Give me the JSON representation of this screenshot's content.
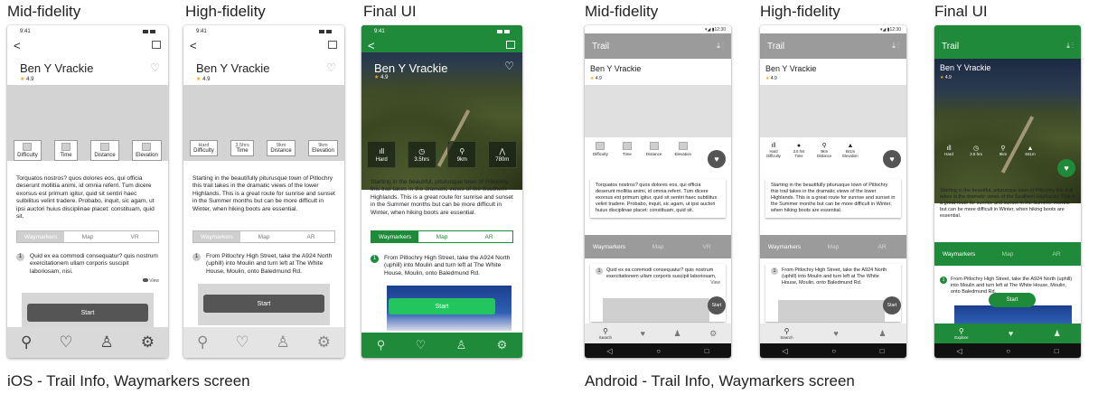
{
  "headings": {
    "ios_mid": "Mid-fidelity",
    "ios_high": "High-fidelity",
    "ios_final": "Final UI",
    "and_mid": "Mid-fidelity",
    "and_high": "High-fidelity",
    "and_final": "Final UI"
  },
  "captions": {
    "ios": "iOS - Trail Info, Waymarkers screen",
    "android": "Android - Trail Info, Waymarkers screen"
  },
  "trail": {
    "name": "Ben Y Vrackie",
    "rating": "4.9",
    "star": "★"
  },
  "status": {
    "ios_time": "9:41",
    "android_time": "12:30"
  },
  "ios_mid": {
    "stats": [
      "Difficulty",
      "Time",
      "Distance",
      "Elevation"
    ],
    "description": "Torquatos nostros? quos dolores eos, qui officia deserunt mollitia animi, id omnia referri. Tum dicere exorsus est primum igitur, quid sit sentiri haec sulbilitus velint tradere. Probabo, inquit, sic agam, ut ipsi auctori huius disciplinae placet: constituam, quid sit.",
    "tabs": [
      "Waymarkers",
      "Map",
      "VR"
    ],
    "step_num": "1",
    "step": "Quid ex ea commodi consequatur? quis nostrum exercitationem ullam corporis suscipit laboriosam, nisi.",
    "step_meta": "View",
    "start": "Start"
  },
  "ios_high": {
    "stats": [
      {
        "value": "Hard",
        "label": "Difficulty"
      },
      {
        "value": "3.5hrs",
        "label": "Time"
      },
      {
        "value": "9km",
        "label": "Distance"
      },
      {
        "value": "9km",
        "label": "Elevation"
      }
    ],
    "description": "Starting in the beautifully piturusque town of Pitlochry this trail takes in the dramatic views of the lower Highlands. This is a great route for sunrise and sunset in the Summer months but can be more difficult in Winter, when hiking boots are essential.",
    "tabs": [
      "Waymarkers",
      "Map",
      "AR"
    ],
    "step_num": "1",
    "step": "From Pitlochry High Street, take the A924 North (uphill) into Moulin and turn left at The White House, Moulin, onto Baledmund Rd.",
    "start": "Start"
  },
  "ios_final": {
    "stats": [
      {
        "icon": "ıll",
        "value": "Hard"
      },
      {
        "icon": "◷",
        "value": "3.5hrs"
      },
      {
        "icon": "⚲",
        "value": "9km"
      },
      {
        "icon": "⋀",
        "value": "780m"
      }
    ],
    "description": "Starting in the beautiful, piturusque town of Pitlochry this trail takes in the dramatic views of the Southern Highlands. This is a great route for sunrise and sunset in the Summer months but can be more difficult in Winter, when hiking boots are essential.",
    "tabs": [
      "Waymarkers",
      "Map",
      "AR"
    ],
    "step_num": "1",
    "step": "From Pitlochry High Street, take the A924 North (uphill) into Moulin and turn left at The White House, Moulin, onto Baledmund Rd.",
    "start": "Start"
  },
  "and_mid": {
    "appbar_title": "Trail",
    "stats": [
      "Difficulty",
      "Time",
      "Distance",
      "Elevation"
    ],
    "description": "Torquatos nostros? quos dolores eos, qui officia deserunt mollitia animi, id omnia referri. Tum dicere exorsus est primum igitur, quid sit sentiri haec subtilitus velint tradere. Probabo, inquit, sic agam, ut ipsi auctori huius disciplinae placet: constituam, quid sit.",
    "tabs": [
      "Waymarkers",
      "Map",
      "VR"
    ],
    "step_num": "1",
    "step": "Quid ex ea commodi consequatur? quis nostrum exercitationem ullam corporis suscipit laboriosam,",
    "step_meta": "View",
    "start": "Start",
    "nav": [
      "Search",
      "",
      "",
      ""
    ]
  },
  "and_high": {
    "appbar_title": "Trail",
    "stats": [
      {
        "value": "Hard",
        "label": "Difficulty"
      },
      {
        "value": "3.5 hrs",
        "label": "Time"
      },
      {
        "value": "9km",
        "label": "Distance"
      },
      {
        "value": "841m",
        "label": "Elevation"
      }
    ],
    "description": "Starting in the beautifully piturusque town of Pitlochry this trail takes in the dramatic views of the lower Highlands. This is a great route for sunrise and sunset in the Summer months but can be more difficult in Winter, when hiking boots are essential.",
    "tabs": [
      "Waymarkers",
      "Map",
      "AR"
    ],
    "step_num": "1",
    "step": "From Pitlochry High Street, take the A924 North (uphill) into Moulin and turn left at The White House, Moulin, onto Baledmund Rd.",
    "start": "Start",
    "nav": [
      "Search",
      "",
      ""
    ]
  },
  "and_final": {
    "appbar_title": "Trail",
    "stats": [
      {
        "icon": "ıll",
        "value": "Hard"
      },
      {
        "icon": "◷",
        "value": "3.5 hrs"
      },
      {
        "icon": "⚲",
        "value": "9km"
      },
      {
        "icon": "▲",
        "value": "841m"
      }
    ],
    "description": "Starting in the beautiful, piturusque town of Pitlochry this trail takes in the dramatic views of the Southern Highlands. This is a great route for sunrise and sunset in the Summer months but can be more difficult in Winter, when hiking boots are essential.",
    "tabs": [
      "Waymarkers",
      "Map",
      "AR"
    ],
    "step_num": "1",
    "step": "From Pitlochry High Street, take the A924 North (uphill) into Moulin and turn left at The White House, Moulin, onto Baledmund Rd.",
    "start": "Start",
    "nav": [
      "Explore",
      "",
      ""
    ]
  },
  "colors": {
    "accent": "#1f8a3a",
    "grey": "#9b9b9b",
    "star": "#f4a300"
  }
}
